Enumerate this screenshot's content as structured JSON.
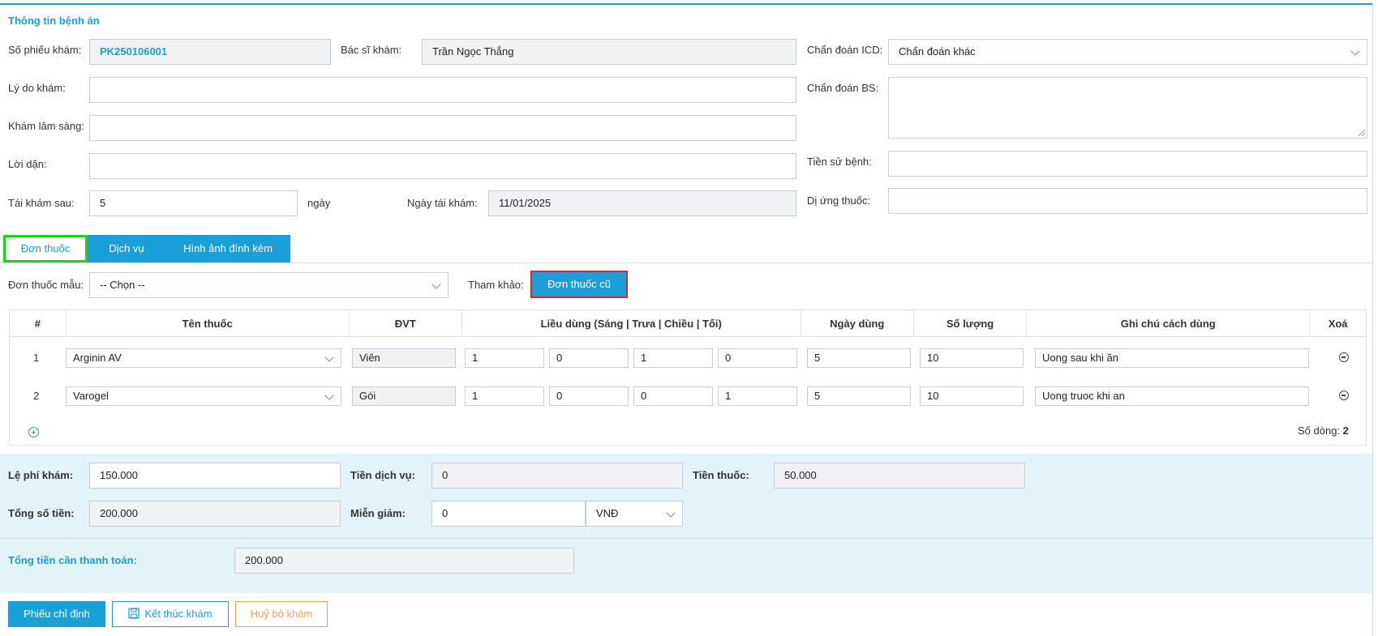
{
  "section_title": "Thông tin bệnh án",
  "form": {
    "so_phieu_label": "Số phiếu khám",
    "so_phieu_value": "PK250106001",
    "bac_si_label": "Bác sĩ khám",
    "bac_si_value": "Trần Ngọc Thắng",
    "chan_doan_icd_label": "Chẩn đoán ICD",
    "chan_doan_icd_value": "Chẩn đoán khác",
    "ly_do_label": "Lý do khám",
    "ly_do_value": "",
    "chan_doan_bs_label": "Chẩn đoán BS",
    "chan_doan_bs_value": "",
    "kham_ls_label": "Khám lâm sàng",
    "kham_ls_value": "",
    "loi_dan_label": "Lời dặn",
    "loi_dan_value": "",
    "tien_su_label": "Tiền sử bệnh",
    "tien_su_value": "",
    "tai_kham_label": "Tái khám sau",
    "tai_kham_value": "5",
    "ngay_unit": "ngày",
    "ngay_tai_kham_label": "Ngày tái khám",
    "ngay_tai_kham_value": "11/01/2025",
    "di_ung_label": "Dị ứng thuốc",
    "di_ung_value": ""
  },
  "tabs": [
    {
      "label": "Đơn thuốc",
      "active": true
    },
    {
      "label": "Dịch vụ",
      "active": false
    },
    {
      "label": "Hình ảnh đính kèm",
      "active": false
    }
  ],
  "prescription": {
    "template_label": "Đơn thuốc mẫu",
    "template_value": "-- Chọn --",
    "reference_label": "Tham khảo:",
    "old_prescription_button": "Đơn thuốc cũ",
    "columns": [
      "#",
      "Tên thuốc",
      "ĐVT",
      "Liều dùng (Sáng | Trưa | Chiều | Tối)",
      "Ngày dùng",
      "Số lượng",
      "Ghi chú cách dùng",
      "Xoá"
    ],
    "rows": [
      {
        "index": "1",
        "drug": "Arginin AV",
        "unit": "Viên",
        "sang": "1",
        "trua": "0",
        "chieu": "1",
        "toi": "0",
        "days": "5",
        "qty": "10",
        "note": "Uong sau khi ăn"
      },
      {
        "index": "2",
        "drug": "Varogel",
        "unit": "Gói",
        "sang": "1",
        "trua": "0",
        "chieu": "0",
        "toi": "1",
        "days": "5",
        "qty": "10",
        "note": "Uong truoc khi an"
      }
    ],
    "row_count_label": "Số dòng:",
    "row_count_value": "2"
  },
  "fees": {
    "le_phi_label": "Lệ phí khám",
    "le_phi_value": "150.000",
    "tien_dv_label": "Tiền dịch vụ",
    "tien_dv_value": "0",
    "tien_thuoc_label": "Tiền thuốc",
    "tien_thuoc_value": "50.000",
    "tong_label": "Tổng số tiền",
    "tong_value": "200.000",
    "mien_giam_label": "Miễn giảm",
    "mien_giam_value": "0",
    "currency_value": "VNĐ",
    "can_tt_label": "Tổng tiền cần thanh toán",
    "can_tt_value": "200.000"
  },
  "actions": {
    "phieu_chi_dinh": "Phiếu chỉ định",
    "ket_thuc": "Kết thúc khám",
    "huy_bo": "Huỷ bỏ khám"
  },
  "colors": {
    "accent": "#1a9fd6",
    "active_tab_border": "#1bd41b",
    "highlight_button_border": "#e0242b",
    "cancel_orange": "#f0a050",
    "fees_bg": "#e2f3fa"
  }
}
